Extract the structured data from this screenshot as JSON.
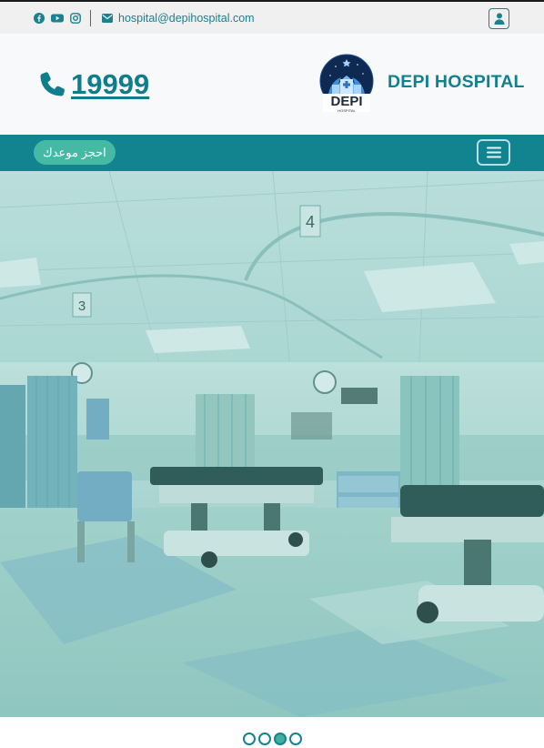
{
  "topbar": {
    "social": [
      "facebook-icon",
      "youtube-icon",
      "instagram-icon"
    ],
    "email": "hospital@depihospital.com"
  },
  "brand": {
    "phone": "19999",
    "name": "DEPI HOSPITAL",
    "logo_text": "DEPI",
    "logo_subtext": "HOSPITAL"
  },
  "nav": {
    "book_button": "احجز موعدك"
  },
  "carousel": {
    "slide_count": 4,
    "active_index": 2
  },
  "colors": {
    "primary": "#12848f",
    "accent": "#46b9a4",
    "topbar_bg": "#f0f0f0",
    "brand_bg": "#f8f9fa"
  }
}
